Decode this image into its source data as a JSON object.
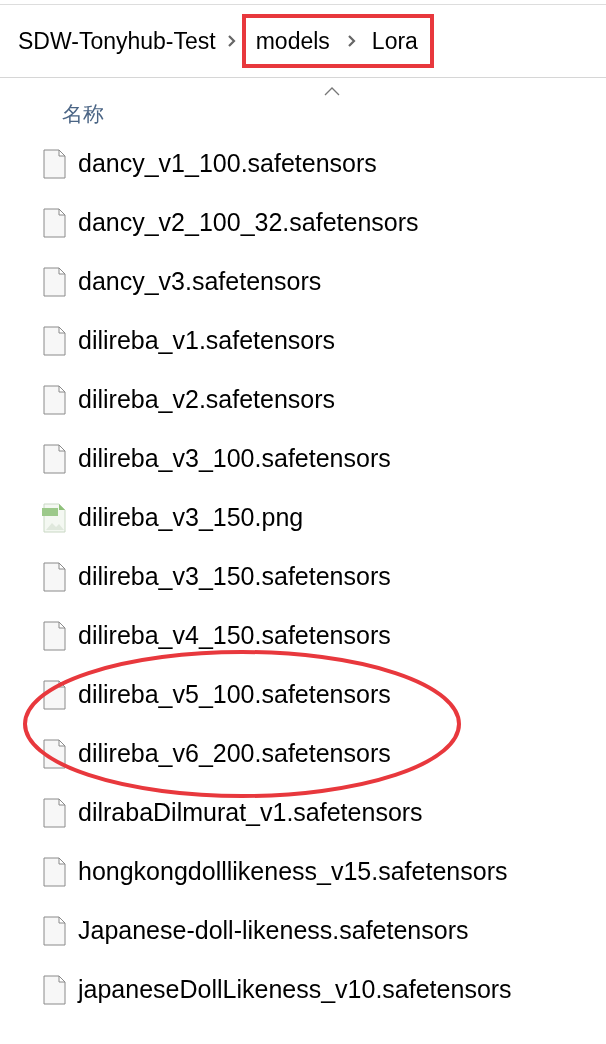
{
  "breadcrumb": [
    {
      "label": "SDW-Tonyhub-Test",
      "highlighted": false
    },
    {
      "label": "models",
      "highlighted": true
    },
    {
      "label": "Lora",
      "highlighted": true
    }
  ],
  "column_header": {
    "label": "名称",
    "sorted": true
  },
  "files": [
    {
      "name": "dancy_v1_100.safetensors",
      "kind": "file",
      "circled": false
    },
    {
      "name": "dancy_v2_100_32.safetensors",
      "kind": "file",
      "circled": false
    },
    {
      "name": "dancy_v3.safetensors",
      "kind": "file",
      "circled": false
    },
    {
      "name": "dilireba_v1.safetensors",
      "kind": "file",
      "circled": false
    },
    {
      "name": "dilireba_v2.safetensors",
      "kind": "file",
      "circled": false
    },
    {
      "name": "dilireba_v3_100.safetensors",
      "kind": "file",
      "circled": false
    },
    {
      "name": "dilireba_v3_150.png",
      "kind": "png",
      "circled": false
    },
    {
      "name": "dilireba_v3_150.safetensors",
      "kind": "file",
      "circled": false
    },
    {
      "name": "dilireba_v4_150.safetensors",
      "kind": "file",
      "circled": false
    },
    {
      "name": "dilireba_v5_100.safetensors",
      "kind": "file",
      "circled": true
    },
    {
      "name": "dilireba_v6_200.safetensors",
      "kind": "file",
      "circled": true
    },
    {
      "name": "dilrabaDilmurat_v1.safetensors",
      "kind": "file",
      "circled": false
    },
    {
      "name": "hongkongdolllikeness_v15.safetensors",
      "kind": "file",
      "circled": false
    },
    {
      "name": "Japanese-doll-likeness.safetensors",
      "kind": "file",
      "circled": false
    },
    {
      "name": "japaneseDollLikeness_v10.safetensors",
      "kind": "file",
      "circled": false
    }
  ]
}
